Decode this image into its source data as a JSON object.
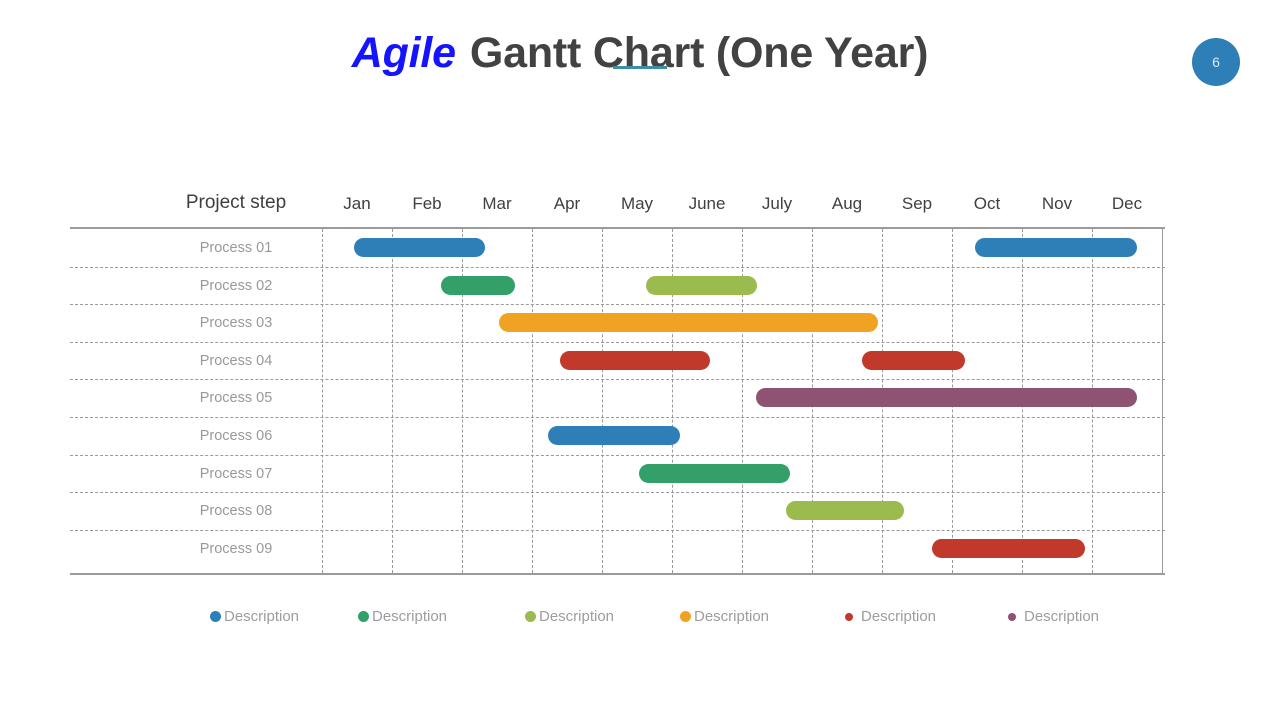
{
  "title": {
    "accent": "Agile",
    "main": "Gantt Chart (One Year)",
    "accent_color": "#1414ff",
    "main_color": "#424242",
    "underline_color": "#3e8fa3"
  },
  "page_badge": {
    "number": "6",
    "color": "#2e7eb8"
  },
  "table": {
    "row_header_label": "Project step",
    "rows": [
      "Process 01",
      "Process 02",
      "Process 03",
      "Process 04",
      "Process 05",
      "Process 06",
      "Process 07",
      "Process 08",
      "Process 09"
    ]
  },
  "legend": {
    "items": [
      {
        "label": "Description",
        "color": "#2e7eb8",
        "size": 11
      },
      {
        "label": "Description",
        "color": "#33a06a",
        "size": 11
      },
      {
        "label": "Description",
        "color": "#9bbb4f",
        "size": 11
      },
      {
        "label": "Description",
        "color": "#f0a322",
        "size": 11
      },
      {
        "label": "Description",
        "color": "#c0392b",
        "size": 8
      },
      {
        "label": "Description",
        "color": "#8e5273",
        "size": 8
      }
    ]
  },
  "chart_data": {
    "type": "bar",
    "chart_kind": "gantt",
    "title": "Agile Gantt Chart (One Year)",
    "xlabel": "",
    "ylabel": "Project step",
    "grid": true,
    "legend_position": "bottom",
    "categories": [
      "Jan",
      "Feb",
      "Mar",
      "Apr",
      "May",
      "June",
      "July",
      "Aug",
      "Sep",
      "Oct",
      "Nov",
      "Dec"
    ],
    "x_axis": {
      "tick_labels": [
        "Jan",
        "Feb",
        "Mar",
        "Apr",
        "May",
        "June",
        "July",
        "Aug",
        "Sep",
        "Oct",
        "Nov",
        "Dec"
      ],
      "units": "months",
      "range": [
        0,
        12
      ]
    },
    "y_axis": {
      "tick_labels": [
        "Process 01",
        "Process 02",
        "Process 03",
        "Process 04",
        "Process 05",
        "Process 06",
        "Process 07",
        "Process 08",
        "Process 09"
      ]
    },
    "tasks": [
      {
        "row": "Process 01",
        "bars": [
          {
            "start_month": 0.45,
            "end_month": 2.33,
            "start_label": "mid-Jan",
            "end_label": "early-Mar",
            "color": "#2e7eb8",
            "series": "Description 1"
          },
          {
            "start_month": 9.33,
            "end_month": 11.64,
            "start_label": "mid-Oct",
            "end_label": "late-Dec",
            "color": "#2e7eb8",
            "series": "Description 1"
          }
        ]
      },
      {
        "row": "Process 02",
        "bars": [
          {
            "start_month": 1.7,
            "end_month": 2.76,
            "start_label": "late-Feb",
            "end_label": "late-Mar",
            "color": "#33a06a",
            "series": "Description 2"
          },
          {
            "start_month": 4.63,
            "end_month": 6.21,
            "start_label": "late-May",
            "end_label": "early-July",
            "color": "#9bbb4f",
            "series": "Description 3"
          }
        ]
      },
      {
        "row": "Process 03",
        "bars": [
          {
            "start_month": 2.53,
            "end_month": 7.94,
            "start_label": "mid-Mar",
            "end_label": "late-Aug",
            "color": "#f0a322",
            "series": "Description 4"
          }
        ]
      },
      {
        "row": "Process 04",
        "bars": [
          {
            "start_month": 3.4,
            "end_month": 5.54,
            "start_label": "mid-Apr",
            "end_label": "mid-June",
            "color": "#c0392b",
            "series": "Description 5"
          },
          {
            "start_month": 7.71,
            "end_month": 9.19,
            "start_label": "late-Aug",
            "end_label": "early-Oct",
            "color": "#c0392b",
            "series": "Description 5"
          }
        ]
      },
      {
        "row": "Process 05",
        "bars": [
          {
            "start_month": 6.2,
            "end_month": 11.64,
            "start_label": "early-July",
            "end_label": "late-Dec",
            "color": "#8e5273",
            "series": "Description 6"
          }
        ]
      },
      {
        "row": "Process 06",
        "bars": [
          {
            "start_month": 3.23,
            "end_month": 5.11,
            "start_label": "early-Apr",
            "end_label": "early-June",
            "color": "#2e7eb8",
            "series": "Description 1"
          }
        ]
      },
      {
        "row": "Process 07",
        "bars": [
          {
            "start_month": 4.53,
            "end_month": 6.69,
            "start_label": "mid-May",
            "end_label": "mid-July",
            "color": "#33a06a",
            "series": "Description 2"
          }
        ]
      },
      {
        "row": "Process 08",
        "bars": [
          {
            "start_month": 6.63,
            "end_month": 8.31,
            "start_label": "mid-July",
            "end_label": "mid-Sep",
            "color": "#9bbb4f",
            "series": "Description 3"
          }
        ]
      },
      {
        "row": "Process 09",
        "bars": [
          {
            "start_month": 8.71,
            "end_month": 10.9,
            "start_label": "late-Sep",
            "end_label": "early-Dec",
            "color": "#c0392b",
            "series": "Description 5"
          }
        ]
      }
    ],
    "series": [
      {
        "name": "Description",
        "color": "#2e7eb8"
      },
      {
        "name": "Description",
        "color": "#33a06a"
      },
      {
        "name": "Description",
        "color": "#9bbb4f"
      },
      {
        "name": "Description",
        "color": "#f0a322"
      },
      {
        "name": "Description",
        "color": "#c0392b"
      },
      {
        "name": "Description",
        "color": "#8e5273"
      }
    ]
  }
}
